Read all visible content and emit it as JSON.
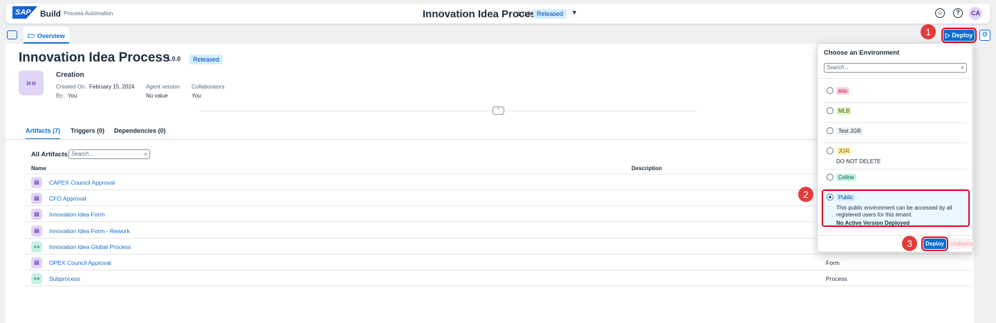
{
  "shell": {
    "logo": "SAP",
    "brand": "Build",
    "product": "Process Automation",
    "title": "Innovation Idea Process",
    "version": "1.0.0",
    "status": "Released",
    "avatar": "CA"
  },
  "tabs": {
    "overview": "Overview"
  },
  "toolbar": {
    "deploy": "Deploy"
  },
  "header": {
    "title": "Innovation Idea Process",
    "version": "1.0.0",
    "status": "Released",
    "section": "Creation",
    "created_on_label": "Created On:",
    "created_on": "February 15, 2024",
    "by_label": "By:",
    "by": "You",
    "agent_label": "Agent version",
    "agent_value": "No value",
    "collab_label": "Collaborators",
    "collab_value": "You"
  },
  "subtabs": {
    "artifacts": "Artifacts (7)",
    "triggers": "Triggers (0)",
    "dependencies": "Dependencies (0)"
  },
  "artifacts": {
    "heading": "All Artifacts",
    "search_placeholder": "Search...",
    "col_name": "Name",
    "col_description": "Description",
    "rows": [
      {
        "name": "CAPEX Council Approval",
        "kind": "form",
        "type": ""
      },
      {
        "name": "CFO Approval",
        "kind": "form",
        "type": ""
      },
      {
        "name": "Innovation Idea Form",
        "kind": "form",
        "type": ""
      },
      {
        "name": "Innovation Idea Form - Rework",
        "kind": "form",
        "type": ""
      },
      {
        "name": "Innovation Idea Global Process",
        "kind": "proc",
        "type": ""
      },
      {
        "name": "OPEX Council Approval",
        "kind": "form",
        "type": "Form"
      },
      {
        "name": "Subprocess",
        "kind": "proc",
        "type": "Process"
      }
    ]
  },
  "popover": {
    "title": "Choose an Environment",
    "search_placeholder": "Search...",
    "options": [
      {
        "tag": "sou",
        "bg": "#ffd0dc",
        "fg": "#a00030"
      },
      {
        "tag": "MLB",
        "bg": "#e6f5c9",
        "fg": "#2b5e00"
      },
      {
        "tag": "Test JGR",
        "bg": "#eef0f2",
        "fg": "#1d2d3e"
      },
      {
        "tag": "JGR",
        "bg": "#fff3b8",
        "fg": "#7a5a00",
        "desc": "DO NOT DELETE"
      },
      {
        "tag": "Celine",
        "bg": "#c7f0e6",
        "fg": "#0e6b55"
      }
    ],
    "public": {
      "tag": "Public",
      "desc": "This public environment can be accessed by all registered users for this tenant.",
      "status": "No Active Version Deployed"
    },
    "deploy": "Deploy",
    "undeploy": "Undeploy"
  },
  "callouts": [
    "1",
    "2",
    "3"
  ]
}
